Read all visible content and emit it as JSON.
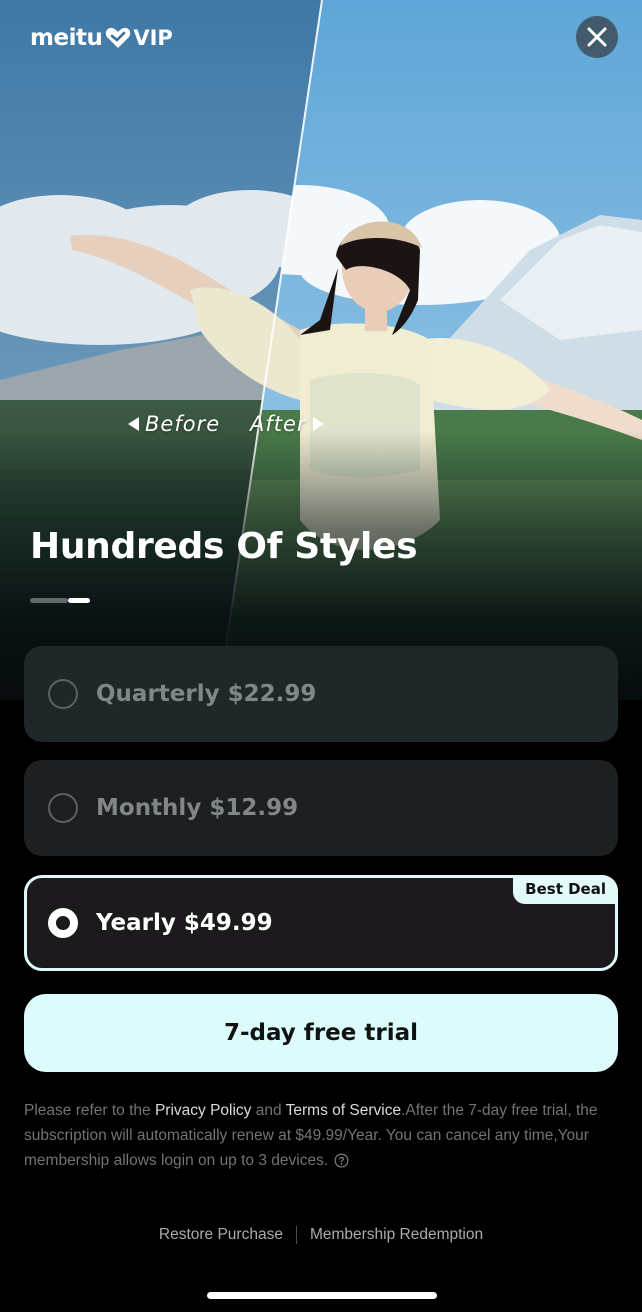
{
  "brand": {
    "logo_text": "meitu",
    "logo_suffix": "VIP"
  },
  "hero": {
    "before_label": "Before",
    "after_label": "After",
    "headline": "Hundreds Of Styles"
  },
  "plans": [
    {
      "label": "Quarterly $22.99",
      "selected": false
    },
    {
      "label": "Monthly $12.99",
      "selected": false
    },
    {
      "label": "Yearly $49.99",
      "selected": true,
      "badge": "Best Deal"
    }
  ],
  "cta": {
    "label": "7-day free trial"
  },
  "terms": {
    "prefix": "Please refer to the ",
    "privacy_link": "Privacy Policy",
    "and": " and ",
    "tos_link": "Terms of Service",
    "body": ".After the 7-day free trial, the subscription will automatically renew at $49.99/Year. You can cancel any time,Your membership allows login on up to 3 devices."
  },
  "footer": {
    "restore": "Restore Purchase",
    "redeem": "Membership Redemption"
  },
  "colors": {
    "accent": "#dcfbfb",
    "background": "#000000"
  },
  "icons": [
    "heart-icon",
    "close-icon",
    "radio-empty-icon",
    "radio-selected-icon",
    "help-circle-icon"
  ]
}
